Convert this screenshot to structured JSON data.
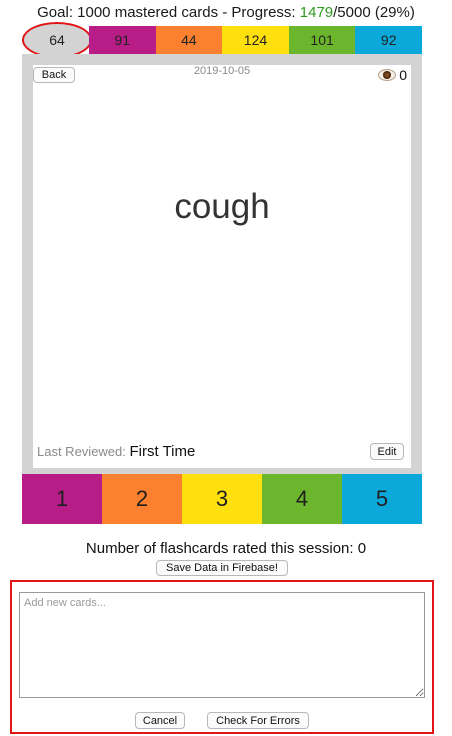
{
  "goal": {
    "prefix": "Goal: 1000 mastered cards - Progress: ",
    "progress_value": "1479",
    "suffix": "/5000 (29%)"
  },
  "strip": {
    "cells": [
      {
        "value": "64",
        "color": "#d3d3d3"
      },
      {
        "value": "91",
        "color": "#b71c87"
      },
      {
        "value": "44",
        "color": "#fb8030"
      },
      {
        "value": "124",
        "color": "#ffe00f"
      },
      {
        "value": "101",
        "color": "#6bb62c"
      },
      {
        "value": "92",
        "color": "#0ba9d9"
      }
    ]
  },
  "card": {
    "back_label": "Back",
    "date": "2019-10-05",
    "views_count": "0",
    "word": "cough",
    "last_reviewed_label": "Last Reviewed:",
    "last_reviewed_value": "First Time",
    "edit_label": "Edit"
  },
  "ratings": [
    {
      "label": "1",
      "color": "#b71c87"
    },
    {
      "label": "2",
      "color": "#fb8030"
    },
    {
      "label": "3",
      "color": "#ffe00f"
    },
    {
      "label": "4",
      "color": "#6bb62c"
    },
    {
      "label": "5",
      "color": "#0ba9d9"
    }
  ],
  "session": {
    "count_text": "Number of flashcards rated this session: 0",
    "save_label": "Save Data in Firebase!"
  },
  "add_cards": {
    "placeholder": "Add new cards...",
    "cancel_label": "Cancel",
    "check_label": "Check For Errors"
  }
}
